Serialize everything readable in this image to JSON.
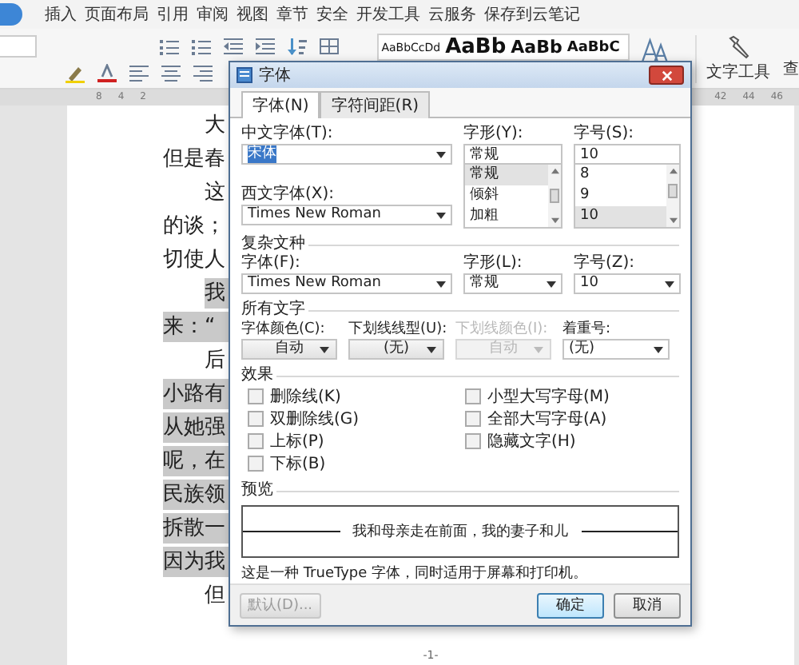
{
  "ribbon_tabs": [
    {
      "label": "插入",
      "selected": false
    },
    {
      "label": "页面布局",
      "selected": false
    },
    {
      "label": "引用",
      "selected": false
    },
    {
      "label": "审阅",
      "selected": false
    },
    {
      "label": "视图",
      "selected": false
    },
    {
      "label": "章节",
      "selected": false
    },
    {
      "label": "安全",
      "selected": false
    },
    {
      "label": "开发工具",
      "selected": false
    },
    {
      "label": "云服务",
      "selected": false
    },
    {
      "label": "保存到云笔记",
      "selected": false
    }
  ],
  "toolbar": {
    "style_samples": [
      "AaBbCcDd",
      "AaBb",
      "AaBb",
      "AaBbC"
    ],
    "text_tools": "文字工具",
    "find_cut": "查"
  },
  "ruler": {
    "left_marks": [
      "8",
      "4",
      "2"
    ],
    "right_marks": [
      "42",
      "44",
      "46"
    ]
  },
  "document": {
    "lines": [
      {
        "text": "大",
        "indented": true,
        "highlighted": false
      },
      {
        "text": "但是春",
        "indented": false,
        "highlighted": false
      },
      {
        "text": "这",
        "indented": true,
        "highlighted": false
      },
      {
        "text": "的谈；",
        "indented": false,
        "highlighted": false
      },
      {
        "text": "切使人",
        "indented": false,
        "highlighted": false
      },
      {
        "text": "我",
        "indented": true,
        "highlighted": true
      },
      {
        "text": "来：“",
        "indented": false,
        "highlighted": true
      },
      {
        "text": "后",
        "indented": true,
        "highlighted": false
      },
      {
        "text": "小路有",
        "indented": false,
        "highlighted": true
      },
      {
        "text": "从她强",
        "indented": false,
        "highlighted": true
      },
      {
        "text": "呢，在",
        "indented": false,
        "highlighted": true
      },
      {
        "text": "民族领",
        "indented": false,
        "highlighted": true
      },
      {
        "text": "拆散一",
        "indented": false,
        "highlighted": true
      },
      {
        "text": "因为我",
        "indented": false,
        "highlighted": true
      },
      {
        "text": "但",
        "indented": true,
        "highlighted": false
      }
    ],
    "page_number": "-1-"
  },
  "dialog": {
    "title": "字体",
    "tabs": [
      {
        "label": "字体(N)",
        "selected": true
      },
      {
        "label": "字符间距(R)",
        "selected": false
      }
    ],
    "chinese_font": {
      "label": "中文字体(T):",
      "value": "宋体",
      "value_selected": true
    },
    "western_font": {
      "label": "西文字体(X):",
      "value": "Times New Roman"
    },
    "style": {
      "label": "字形(Y):",
      "value": "常规",
      "options": [
        {
          "label": "常规",
          "selected": true
        },
        {
          "label": "倾斜",
          "selected": false
        },
        {
          "label": "加粗",
          "selected": false
        }
      ]
    },
    "size": {
      "label": "字号(S):",
      "value": "10",
      "options": [
        {
          "label": "8",
          "selected": false
        },
        {
          "label": "9",
          "selected": false
        },
        {
          "label": "10",
          "selected": true
        }
      ]
    },
    "complex_script": {
      "title": "复杂文种",
      "fields": [
        {
          "label": "字体(F):",
          "value": "Times New Roman"
        },
        {
          "label": "字形(L):",
          "value": "常规"
        },
        {
          "label": "字号(Z):",
          "value": "10"
        }
      ]
    },
    "all_text": {
      "title": "所有文字",
      "fields": [
        {
          "label": "字体颜色(C):",
          "value": "自动",
          "kind": "picker",
          "disabled": false
        },
        {
          "label": "下划线线型(U):",
          "value": "(无)",
          "kind": "picker",
          "disabled": false
        },
        {
          "label": "下划线颜色(I):",
          "value": "自动",
          "kind": "picker",
          "disabled": true
        },
        {
          "label": "着重号:",
          "value": "(无)",
          "kind": "select",
          "disabled": false
        }
      ]
    },
    "effects": {
      "title": "效果",
      "column_1": [
        {
          "label": "删除线(K)",
          "checked": false
        },
        {
          "label": "双删除线(G)",
          "checked": false
        },
        {
          "label": "上标(P)",
          "checked": false
        },
        {
          "label": "下标(B)",
          "checked": false
        }
      ],
      "column_2": [
        {
          "label": "小型大写字母(M)",
          "checked": false
        },
        {
          "label": "全部大写字母(A)",
          "checked": false
        },
        {
          "label": "隐藏文字(H)",
          "checked": false
        }
      ]
    },
    "preview": {
      "title": "预览",
      "sample": "我和母亲走在前面，我的妻子和儿",
      "note": "这是一种 TrueType 字体，同时适用于屏幕和打印机。"
    },
    "buttons": [
      {
        "label": "默认(D)...",
        "kind": "secondary",
        "disabled": true
      },
      {
        "label": "确定",
        "kind": "primary",
        "disabled": false
      },
      {
        "label": "取消",
        "kind": "normal",
        "disabled": false
      }
    ]
  }
}
